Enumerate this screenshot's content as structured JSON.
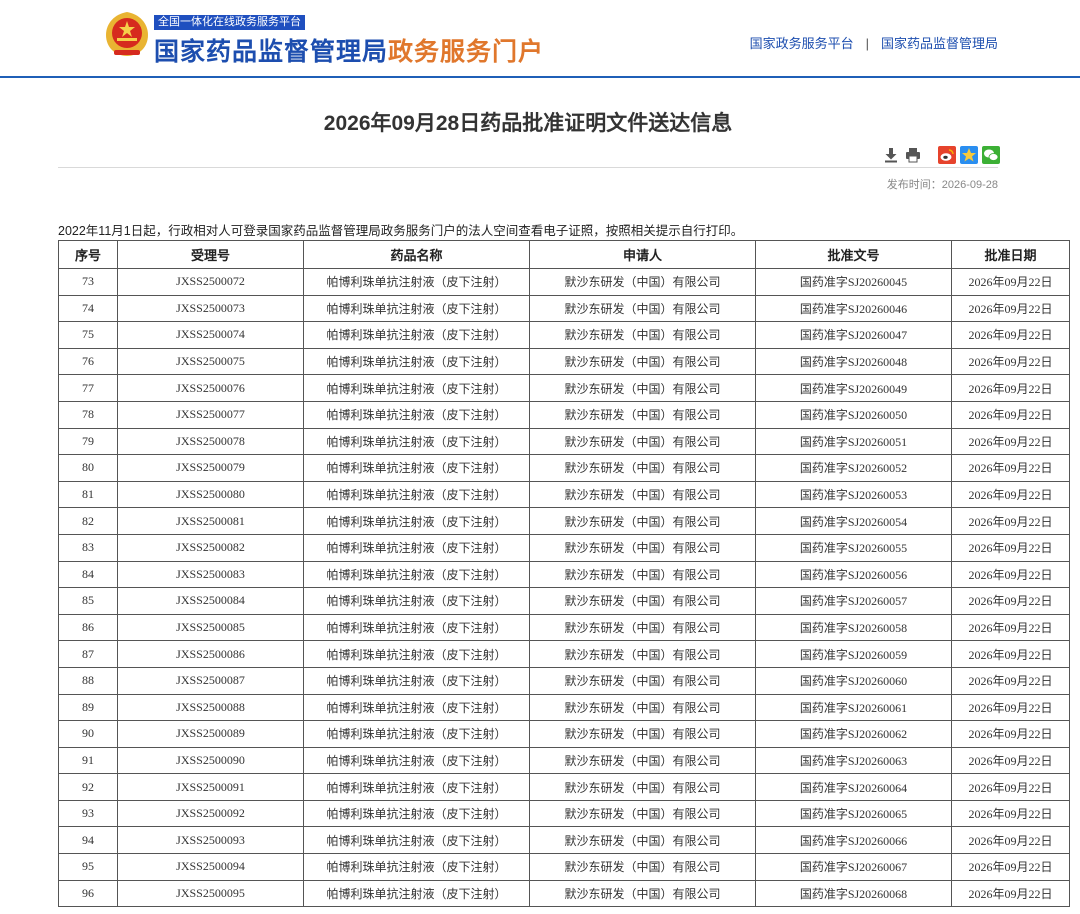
{
  "header": {
    "tagline": "全国一体化在线政务服务平台",
    "title_main": "国家药品监督管理局",
    "title_accent": "政务服务门户",
    "links": [
      "国家政务服务平台",
      "国家药品监督管理局"
    ],
    "link_separator": "|"
  },
  "article": {
    "title": "2026年09月28日药品批准证明文件送达信息",
    "publish_time": "发布时间：2026-09-28",
    "notice": "2022年11月1日起，行政相对人可登录国家药品监督管理局政务服务门户的法人空间查看电子证照，按照相关提示自行打印。"
  },
  "share_icons": [
    "download-icon",
    "print-icon",
    "weibo-icon",
    "qzone-icon",
    "wechat-icon"
  ],
  "colors": {
    "brand_blue": "#1d4eaf",
    "accent_orange": "#e0772c",
    "header_rule": "#1f5fb7"
  },
  "table": {
    "headers": [
      "序号",
      "受理号",
      "药品名称",
      "申请人",
      "批准文号",
      "批准日期"
    ],
    "rows": [
      [
        "73",
        "JXSS2500072",
        "帕博利珠单抗注射液（皮下注射）",
        "默沙东研发（中国）有限公司",
        "国药准字SJ20260045",
        "2026年09月22日"
      ],
      [
        "74",
        "JXSS2500073",
        "帕博利珠单抗注射液（皮下注射）",
        "默沙东研发（中国）有限公司",
        "国药准字SJ20260046",
        "2026年09月22日"
      ],
      [
        "75",
        "JXSS2500074",
        "帕博利珠单抗注射液（皮下注射）",
        "默沙东研发（中国）有限公司",
        "国药准字SJ20260047",
        "2026年09月22日"
      ],
      [
        "76",
        "JXSS2500075",
        "帕博利珠单抗注射液（皮下注射）",
        "默沙东研发（中国）有限公司",
        "国药准字SJ20260048",
        "2026年09月22日"
      ],
      [
        "77",
        "JXSS2500076",
        "帕博利珠单抗注射液（皮下注射）",
        "默沙东研发（中国）有限公司",
        "国药准字SJ20260049",
        "2026年09月22日"
      ],
      [
        "78",
        "JXSS2500077",
        "帕博利珠单抗注射液（皮下注射）",
        "默沙东研发（中国）有限公司",
        "国药准字SJ20260050",
        "2026年09月22日"
      ],
      [
        "79",
        "JXSS2500078",
        "帕博利珠单抗注射液（皮下注射）",
        "默沙东研发（中国）有限公司",
        "国药准字SJ20260051",
        "2026年09月22日"
      ],
      [
        "80",
        "JXSS2500079",
        "帕博利珠单抗注射液（皮下注射）",
        "默沙东研发（中国）有限公司",
        "国药准字SJ20260052",
        "2026年09月22日"
      ],
      [
        "81",
        "JXSS2500080",
        "帕博利珠单抗注射液（皮下注射）",
        "默沙东研发（中国）有限公司",
        "国药准字SJ20260053",
        "2026年09月22日"
      ],
      [
        "82",
        "JXSS2500081",
        "帕博利珠单抗注射液（皮下注射）",
        "默沙东研发（中国）有限公司",
        "国药准字SJ20260054",
        "2026年09月22日"
      ],
      [
        "83",
        "JXSS2500082",
        "帕博利珠单抗注射液（皮下注射）",
        "默沙东研发（中国）有限公司",
        "国药准字SJ20260055",
        "2026年09月22日"
      ],
      [
        "84",
        "JXSS2500083",
        "帕博利珠单抗注射液（皮下注射）",
        "默沙东研发（中国）有限公司",
        "国药准字SJ20260056",
        "2026年09月22日"
      ],
      [
        "85",
        "JXSS2500084",
        "帕博利珠单抗注射液（皮下注射）",
        "默沙东研发（中国）有限公司",
        "国药准字SJ20260057",
        "2026年09月22日"
      ],
      [
        "86",
        "JXSS2500085",
        "帕博利珠单抗注射液（皮下注射）",
        "默沙东研发（中国）有限公司",
        "国药准字SJ20260058",
        "2026年09月22日"
      ],
      [
        "87",
        "JXSS2500086",
        "帕博利珠单抗注射液（皮下注射）",
        "默沙东研发（中国）有限公司",
        "国药准字SJ20260059",
        "2026年09月22日"
      ],
      [
        "88",
        "JXSS2500087",
        "帕博利珠单抗注射液（皮下注射）",
        "默沙东研发（中国）有限公司",
        "国药准字SJ20260060",
        "2026年09月22日"
      ],
      [
        "89",
        "JXSS2500088",
        "帕博利珠单抗注射液（皮下注射）",
        "默沙东研发（中国）有限公司",
        "国药准字SJ20260061",
        "2026年09月22日"
      ],
      [
        "90",
        "JXSS2500089",
        "帕博利珠单抗注射液（皮下注射）",
        "默沙东研发（中国）有限公司",
        "国药准字SJ20260062",
        "2026年09月22日"
      ],
      [
        "91",
        "JXSS2500090",
        "帕博利珠单抗注射液（皮下注射）",
        "默沙东研发（中国）有限公司",
        "国药准字SJ20260063",
        "2026年09月22日"
      ],
      [
        "92",
        "JXSS2500091",
        "帕博利珠单抗注射液（皮下注射）",
        "默沙东研发（中国）有限公司",
        "国药准字SJ20260064",
        "2026年09月22日"
      ],
      [
        "93",
        "JXSS2500092",
        "帕博利珠单抗注射液（皮下注射）",
        "默沙东研发（中国）有限公司",
        "国药准字SJ20260065",
        "2026年09月22日"
      ],
      [
        "94",
        "JXSS2500093",
        "帕博利珠单抗注射液（皮下注射）",
        "默沙东研发（中国）有限公司",
        "国药准字SJ20260066",
        "2026年09月22日"
      ],
      [
        "95",
        "JXSS2500094",
        "帕博利珠单抗注射液（皮下注射）",
        "默沙东研发（中国）有限公司",
        "国药准字SJ20260067",
        "2026年09月22日"
      ],
      [
        "96",
        "JXSS2500095",
        "帕博利珠单抗注射液（皮下注射）",
        "默沙东研发（中国）有限公司",
        "国药准字SJ20260068",
        "2026年09月22日"
      ]
    ]
  }
}
